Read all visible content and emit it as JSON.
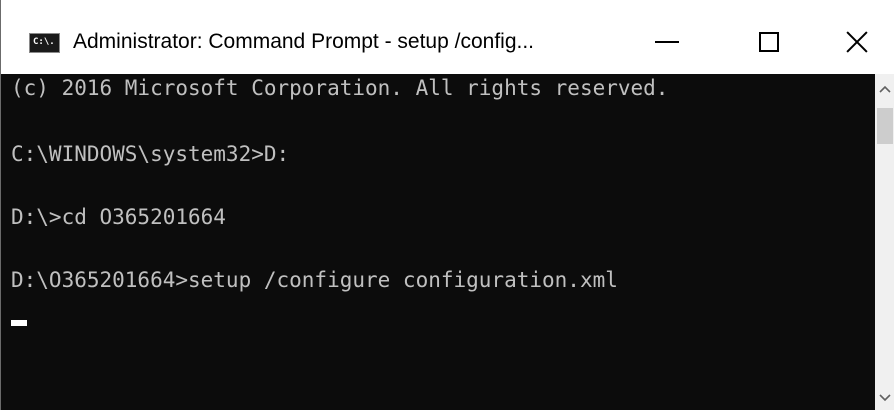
{
  "window": {
    "title": "Administrator: Command Prompt - setup  /config...",
    "icon_label": "C:\\."
  },
  "controls": {
    "minimize": "minimize-icon",
    "maximize": "maximize-icon",
    "close": "close-icon"
  },
  "console": {
    "lines": [
      "(c) 2016 Microsoft Corporation. All rights reserved.",
      "",
      "C:\\WINDOWS\\system32>D:",
      "",
      "D:\\>cd O365201664",
      "",
      "D:\\O365201664>setup /configure configuration.xml"
    ],
    "background": "#0c0c0c",
    "foreground": "#c0c0c0"
  }
}
